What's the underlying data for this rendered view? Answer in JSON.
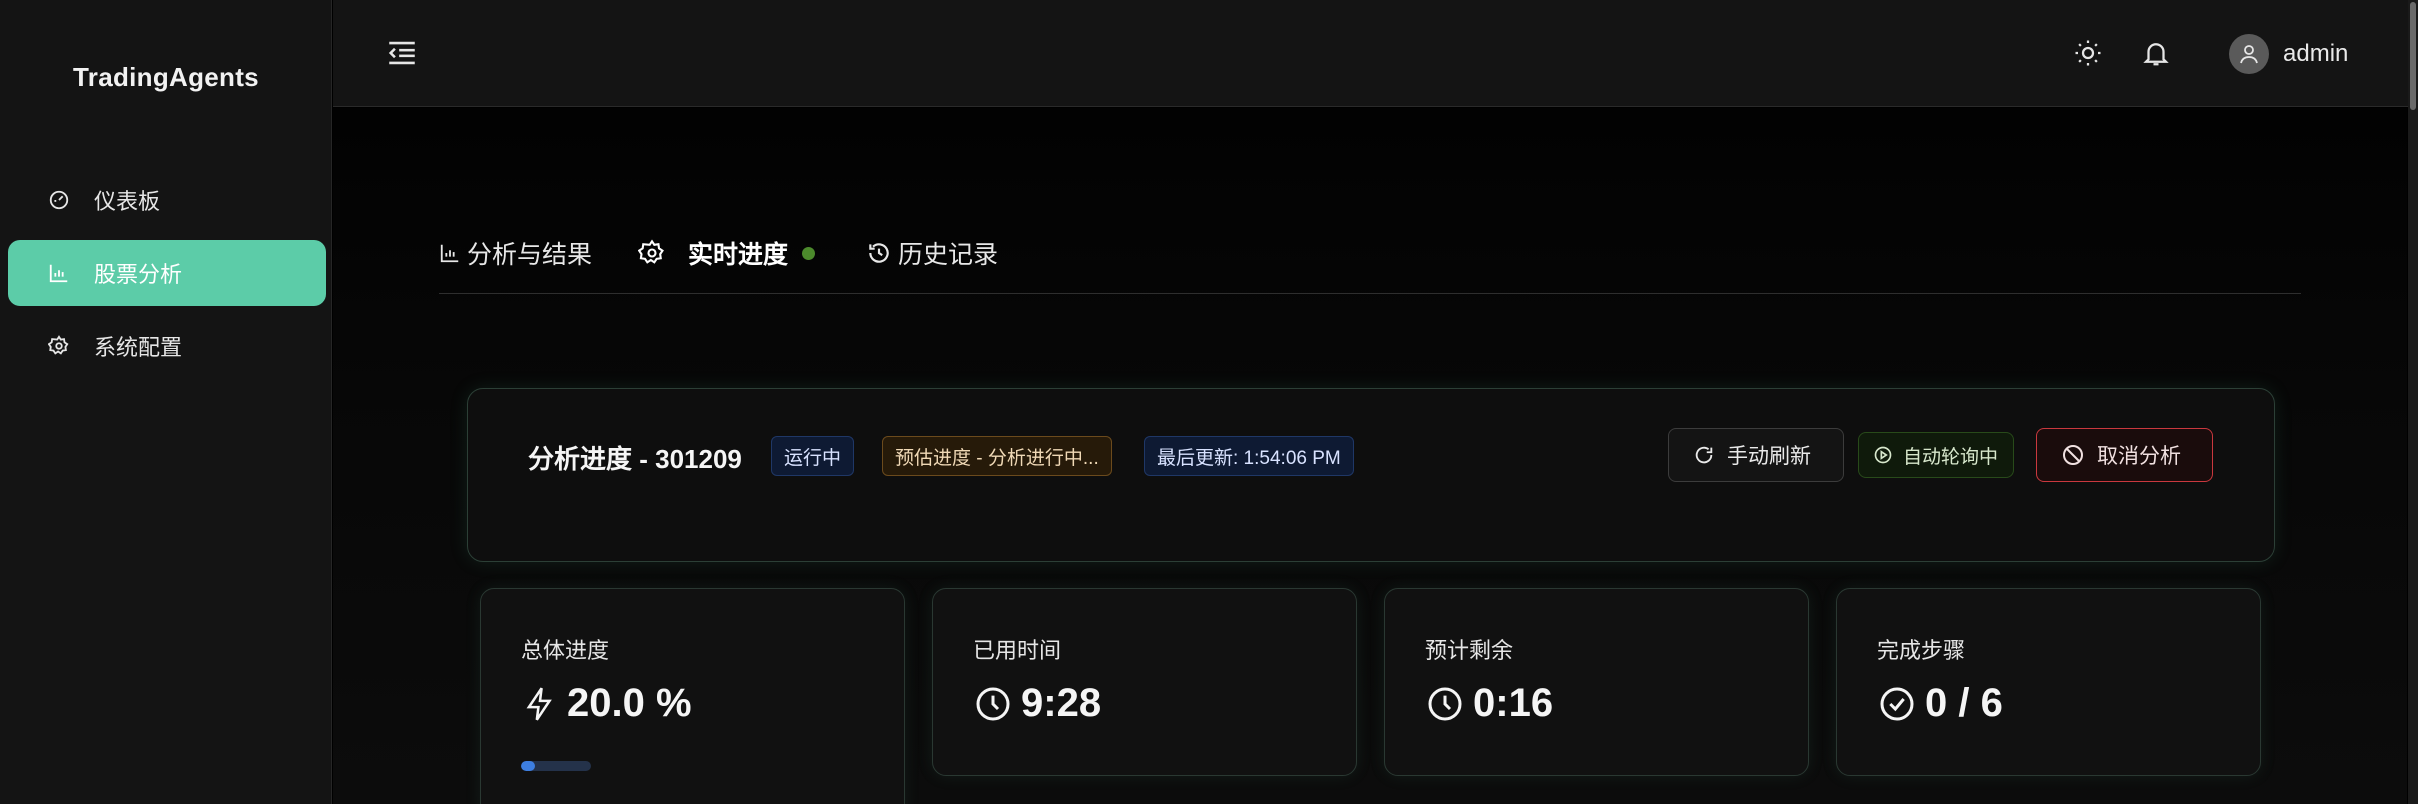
{
  "app": {
    "brand": "TradingAgents"
  },
  "sidebar": {
    "items": [
      {
        "label": "仪表板",
        "icon": "dashboard-icon",
        "active": false
      },
      {
        "label": "股票分析",
        "icon": "bar-chart-icon",
        "active": true
      },
      {
        "label": "系统配置",
        "icon": "gear-icon",
        "active": false
      }
    ]
  },
  "header": {
    "menu_icon": "menu-fold-icon",
    "theme_icon": "sun-icon",
    "notification_icon": "bell-icon",
    "user": {
      "name": "admin",
      "avatar_icon": "user-icon"
    }
  },
  "tabs": [
    {
      "label": "分析与结果",
      "icon": "bar-chart-icon",
      "active": false
    },
    {
      "label": "实时进度",
      "icon": "gear-icon",
      "active": true,
      "status_dot": true
    },
    {
      "label": "历史记录",
      "icon": "history-icon",
      "active": false
    }
  ],
  "progress_panel": {
    "title": "分析进度 - 301209",
    "status_tag": "运行中",
    "estimate_tag": "预估进度 - 分析进行中...",
    "updated_tag": "最后更新: 1:54:06 PM",
    "buttons": {
      "refresh": "手动刷新",
      "auto_poll": "自动轮询中",
      "cancel": "取消分析"
    }
  },
  "stats": {
    "overall": {
      "label": "总体进度",
      "value": "20.0 %",
      "icon": "lightning-icon",
      "progress": 0.2
    },
    "elapsed": {
      "label": "已用时间",
      "value": "9:28",
      "icon": "clock-icon"
    },
    "remaining": {
      "label": "预计剩余",
      "value": "0:16",
      "icon": "clock-icon"
    },
    "steps": {
      "label": "完成步骤",
      "value": "0 / 6",
      "icon": "check-circle-icon"
    }
  },
  "colors": {
    "accent": "#5ccca8",
    "status_dot": "#4c8a2c",
    "cancel_border": "#c9383e",
    "progress_fill": "#3d7ee0"
  }
}
